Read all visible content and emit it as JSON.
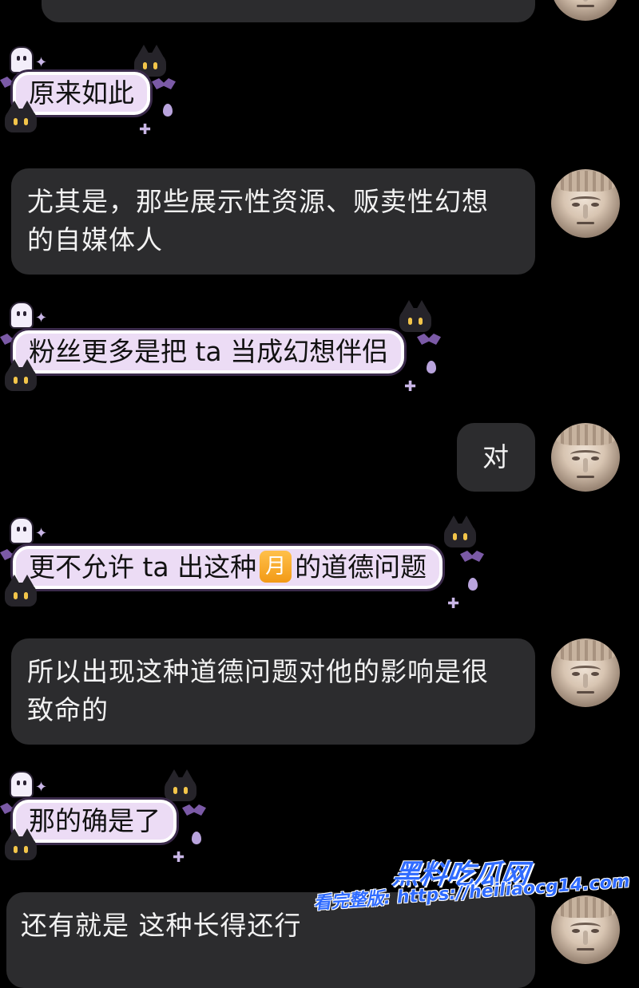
{
  "messages": [
    {
      "side": "right",
      "style": "dark",
      "lines": [
        ""
      ]
    },
    {
      "side": "left",
      "style": "cute",
      "text": "原来如此"
    },
    {
      "side": "right",
      "style": "dark",
      "lines": [
        "尤其是，那些展示性资源、贩卖性幻想",
        "的自媒体人"
      ]
    },
    {
      "side": "left",
      "style": "cute",
      "text": "粉丝更多是把 ta 当成幻想伴侣"
    },
    {
      "side": "right",
      "style": "dark",
      "lines": [
        "对"
      ]
    },
    {
      "side": "left",
      "style": "cute",
      "text_before": "更不允许 ta 出这种",
      "emoji": "月",
      "text_after": "的道德问题"
    },
    {
      "side": "right",
      "style": "dark",
      "lines": [
        "所以出现这种道德问题对他的影响是很",
        "致命的"
      ]
    },
    {
      "side": "left",
      "style": "cute",
      "text": "那的确是了"
    },
    {
      "side": "right",
      "style": "dark",
      "lines": [
        "还有就是 这种长得还行"
      ]
    }
  ],
  "watermark": {
    "brand": "黑料吃瓜网",
    "url": "看完整版: https://heiliaocg14.com"
  },
  "colors": {
    "background": "#000000",
    "dark_bubble": "#2c2c2e",
    "cute_bubble": "#ecdcf5",
    "watermark": "#2f6bff"
  }
}
